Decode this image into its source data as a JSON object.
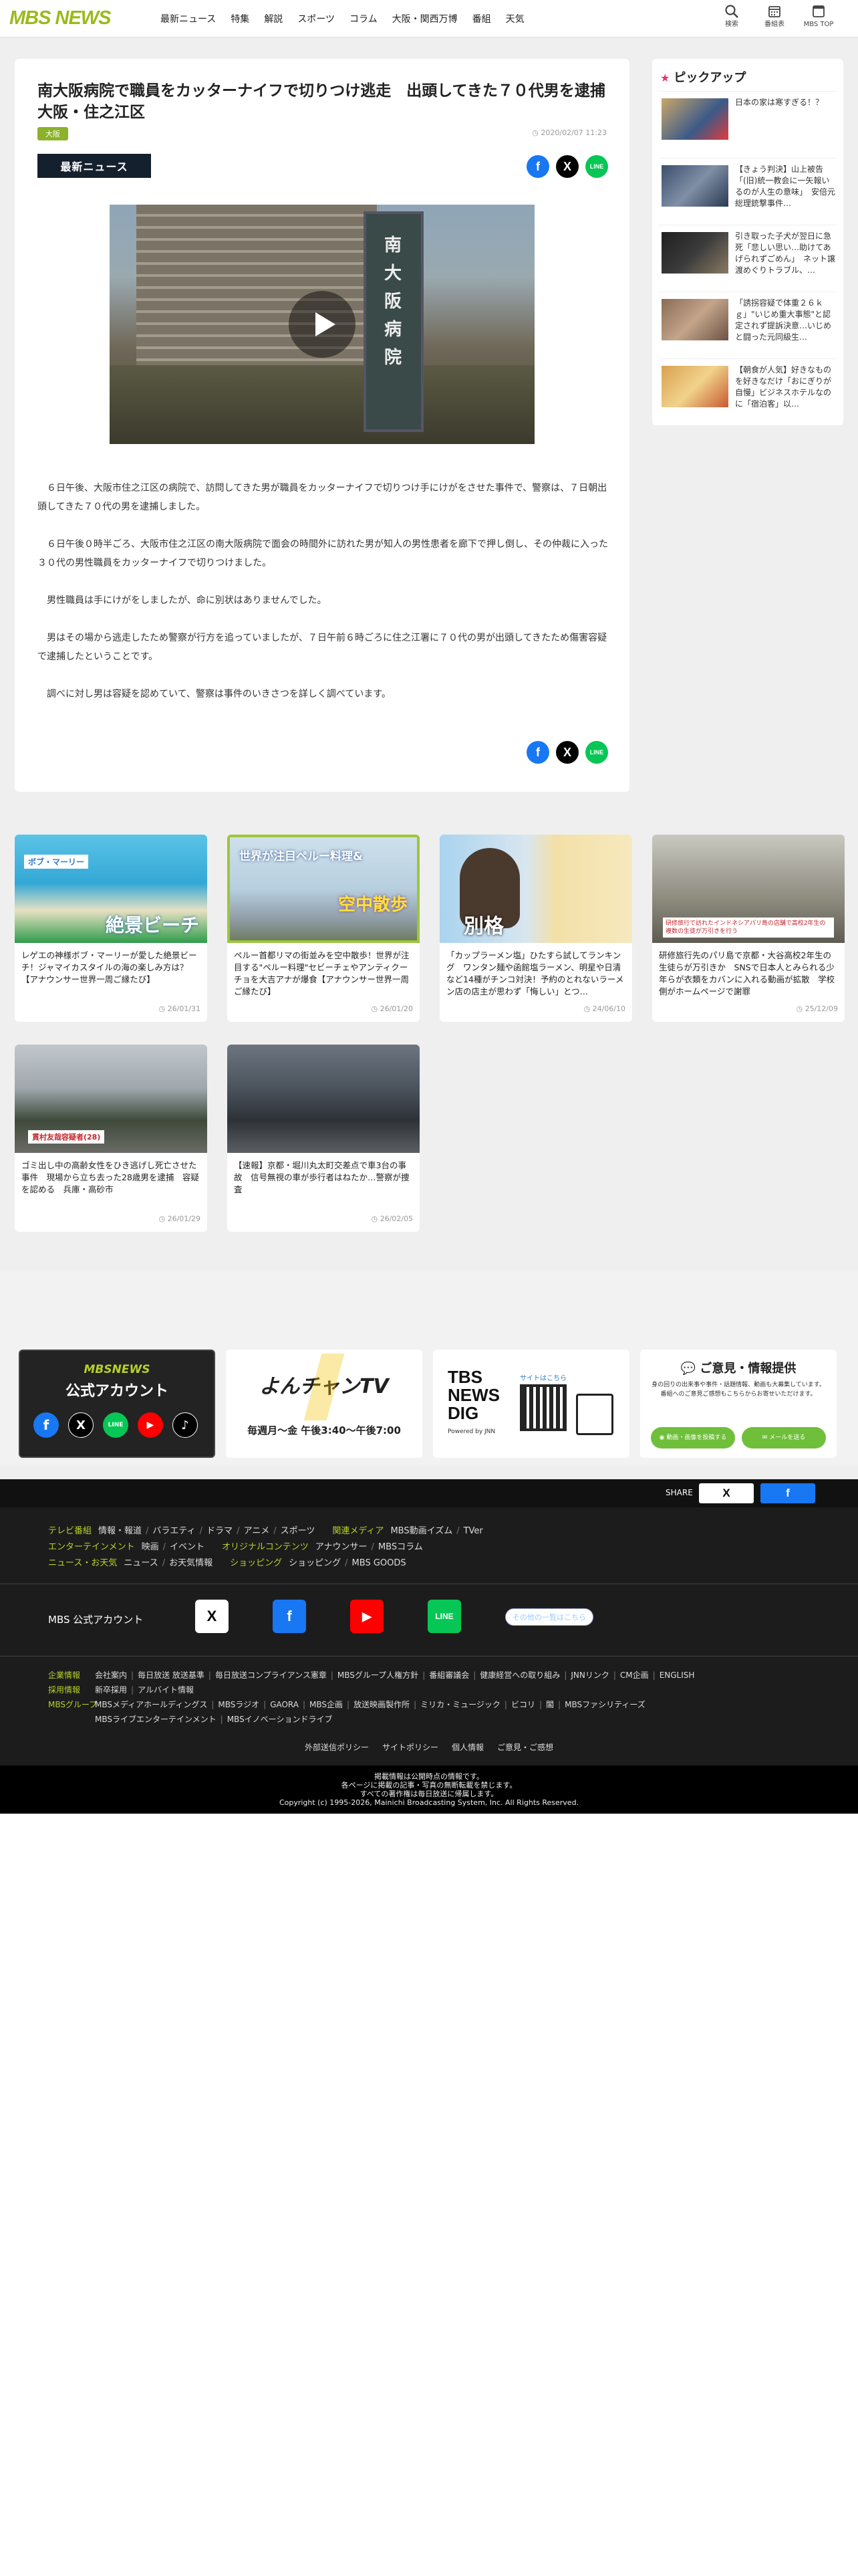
{
  "brand": {
    "logo": "MBS NEWS",
    "accent": "#9ab91c"
  },
  "nav": [
    "最新ニュース",
    "特集",
    "解説",
    "スポーツ",
    "コラム",
    "大阪・関西万博",
    "番組",
    "天気"
  ],
  "header_buttons": [
    {
      "label": "検索",
      "icon": "search-icon"
    },
    {
      "label": "番組表",
      "icon": "calendar-icon"
    },
    {
      "label": "MBS TOP",
      "icon": "home-icon"
    }
  ],
  "article": {
    "title": "南大阪病院で職員をカッターナイフで切りつけ逃走　出頭してきた７０代男を逮捕　大阪・住之江区",
    "area": "大阪",
    "date": "2020/02/07 11:23",
    "section_label": "最新ニュース",
    "video_sign": "南大阪病院",
    "body": [
      "６日午後、大阪市住之江区の病院で、訪問してきた男が職員をカッターナイフで切りつけ手にけがをさせた事件で、警察は、７日朝出頭してきた７０代の男を逮捕しました。",
      "６日午後０時半ごろ、大阪市住之江区の南大阪病院で面会の時間外に訪れた男が知人の男性患者を廊下で押し倒し、その仲裁に入った３０代の男性職員をカッターナイフで切りつけました。",
      "男性職員は手にけがをしましたが、命に別状はありませんでした。",
      "男はその場から逃走したため警察が行方を追っていましたが、７日午前６時ごろに住之江署に７０代の男が出頭してきたため傷害容疑で逮捕したということです。",
      "調べに対し男は容疑を認めていて、警察は事件のいきさつを詳しく調べています。"
    ]
  },
  "pickup": {
    "heading": "ピックアップ",
    "items": [
      {
        "text": "日本の家は寒すぎる！？"
      },
      {
        "text": "【きょう判決】山上被告「(旧)統一教会に一矢報いるのが人生の意味」　安倍元総理銃撃事件…"
      },
      {
        "text": "引き取った子犬が翌日に急死「悲しい思い…助けてあげられずごめん」　ネット譲渡めぐりトラブル、…"
      },
      {
        "text": "「誘拐容疑で体重２６ｋｇ」\"いじめ重大事態\"と認定されず提訴決意…いじめと闘った元同級生…"
      },
      {
        "text": "【朝食が人気】好きなものを好きなだけ「おにぎりが自慢」ビジネスホテルなのに「宿泊客」以…"
      }
    ]
  },
  "cards": [
    {
      "title": "レゲエの神様ボブ・マーリーが愛した絶景ビーチ！ジャマイカスタイルの海の楽しみ方は？【アナウンサー世界一周ご縁たび】",
      "date": "26/01/31"
    },
    {
      "title": "ペルー首都リマの街並みを空中散歩！世界が注目する\"ペルー料理\"セビーチェやアンティクーチョを大吉アナが爆食【アナウンサー世界一周ご縁たび】",
      "date": "26/01/20"
    },
    {
      "title": "「カップラーメン塩」ひたすら試してランキング　ワンタン麺や函館塩ラーメン、明星や日清など14種がチンコ対決！予約のとれないラーメン店の店主が思わず「悔しい」とつ…",
      "date": "24/06/10"
    },
    {
      "title": "研修旅行先のパリ島で京都・大谷高校2年生の生徒らが万引きか　SNSで日本人とみられる少年らが衣類をカバンに入れる動画が拡散　学校側がホームページで謝罪",
      "date": "25/12/09"
    },
    {
      "title": "ゴミ出し中の高齢女性をひき逃げし死亡させた事件　現場から立ち去った28歳男を逮捕　容疑を認める　兵庫・高砂市",
      "date": "26/01/29"
    },
    {
      "title": "【速報】京都・堀川丸太町交差点で車3台の事故　信号無視の車が歩行者はねたか…警察が捜査",
      "date": "26/02/05"
    }
  ],
  "card_overlays": {
    "c1_top": "ボブ・マーリー",
    "c1_bottom": "絶景ビーチ",
    "c2_top": "世界が注目ペルー料理&",
    "c2_bottom": "空中散歩",
    "c3": "別格",
    "c4": "研修旅行で訪れたインドネシアパリ島の店舗で高校2年生の複数の生徒が万引きを行う",
    "c5": "貫村友哉容疑者(28)"
  },
  "banners": {
    "official": {
      "title": "MBSNEWS",
      "sub": "公式アカウント"
    },
    "yonchan": {
      "logo": "よんチャンTV",
      "schedule": "毎週月～金 午後3:40～午後7:00"
    },
    "newsdig": {
      "logo": "TBS NEWS DIG",
      "powered": "Powered by JNN",
      "qr_note": "サイトはこちら"
    },
    "opinion": {
      "title": "ご意見・情報提供",
      "desc": "身の回りの出来事や事件・話題情報、動画も大募集しています。番組へのご意見ご感想もこちらからお寄せいただけます。",
      "btn1": "動画・画像を投稿する",
      "btn2": "メールを送る"
    }
  },
  "share_bar": {
    "label": "SHARE"
  },
  "footer": {
    "rows": [
      [
        {
          "cat": "テレビ番組",
          "items": [
            "情報・報道",
            "バラエティ",
            "ドラマ",
            "アニメ",
            "スポーツ"
          ]
        },
        {
          "cat": "関連メディア",
          "items": [
            "MBS動画イズム",
            "TVer"
          ]
        }
      ],
      [
        {
          "cat": "エンターテインメント",
          "items": [
            "映画",
            "イベント"
          ]
        },
        {
          "cat": "オリジナルコンテンツ",
          "items": [
            "アナウンサー",
            "MBSコラム"
          ]
        }
      ],
      [
        {
          "cat": "ニュース・お天気",
          "items": [
            "ニュース",
            "お天気情報"
          ]
        },
        {
          "cat": "ショッピング",
          "items": [
            "ショッピング",
            "MBS GOODS"
          ]
        }
      ]
    ],
    "sns_label": "MBS 公式アカウント",
    "sns_more": "その他の一覧はこちら",
    "corp": [
      {
        "cat": "企業情報",
        "items": [
          "会社案内",
          "毎日放送 放送基準",
          "毎日放送コンプライアンス憲章",
          "MBSグループ人権方針",
          "番組審議会",
          "健康経営への取り組み",
          "JNNリンク",
          "CM企画",
          "ENGLISH"
        ]
      },
      {
        "cat": "採用情報",
        "items": [
          "新卒採用",
          "アルバイト情報"
        ]
      },
      {
        "cat": "MBSグループ",
        "items": [
          "MBSメディアホールディングス",
          "MBSラジオ",
          "GAORA",
          "MBS企画",
          "放送映画製作所",
          "ミリカ・ミュージック",
          "ビコリ",
          "閣",
          "MBSファシリティーズ"
        ]
      },
      {
        "cat": "",
        "items": [
          "MBSライブエンターテインメント",
          "MBSイノベーションドライブ"
        ]
      }
    ],
    "policy": [
      "外部送信ポリシー",
      "サイトポリシー",
      "個人情報",
      "ご意見・ご感想"
    ],
    "copyright": [
      "掲載情報は公開時点の情報です。",
      "各ページに掲載の記事・写真の無断転載を禁じます。",
      "すべての著作権は毎日放送に帰属します。",
      "Copyright (c) 1995-2026, Mainichi Broadcasting System, Inc. All Rights Reserved."
    ]
  },
  "colors": {
    "facebook": "#1877f2",
    "x": "#000000",
    "line": "#06c755",
    "youtube": "#ff0000",
    "badge": "#8bb22a",
    "pickup_star": "#e4366f"
  }
}
